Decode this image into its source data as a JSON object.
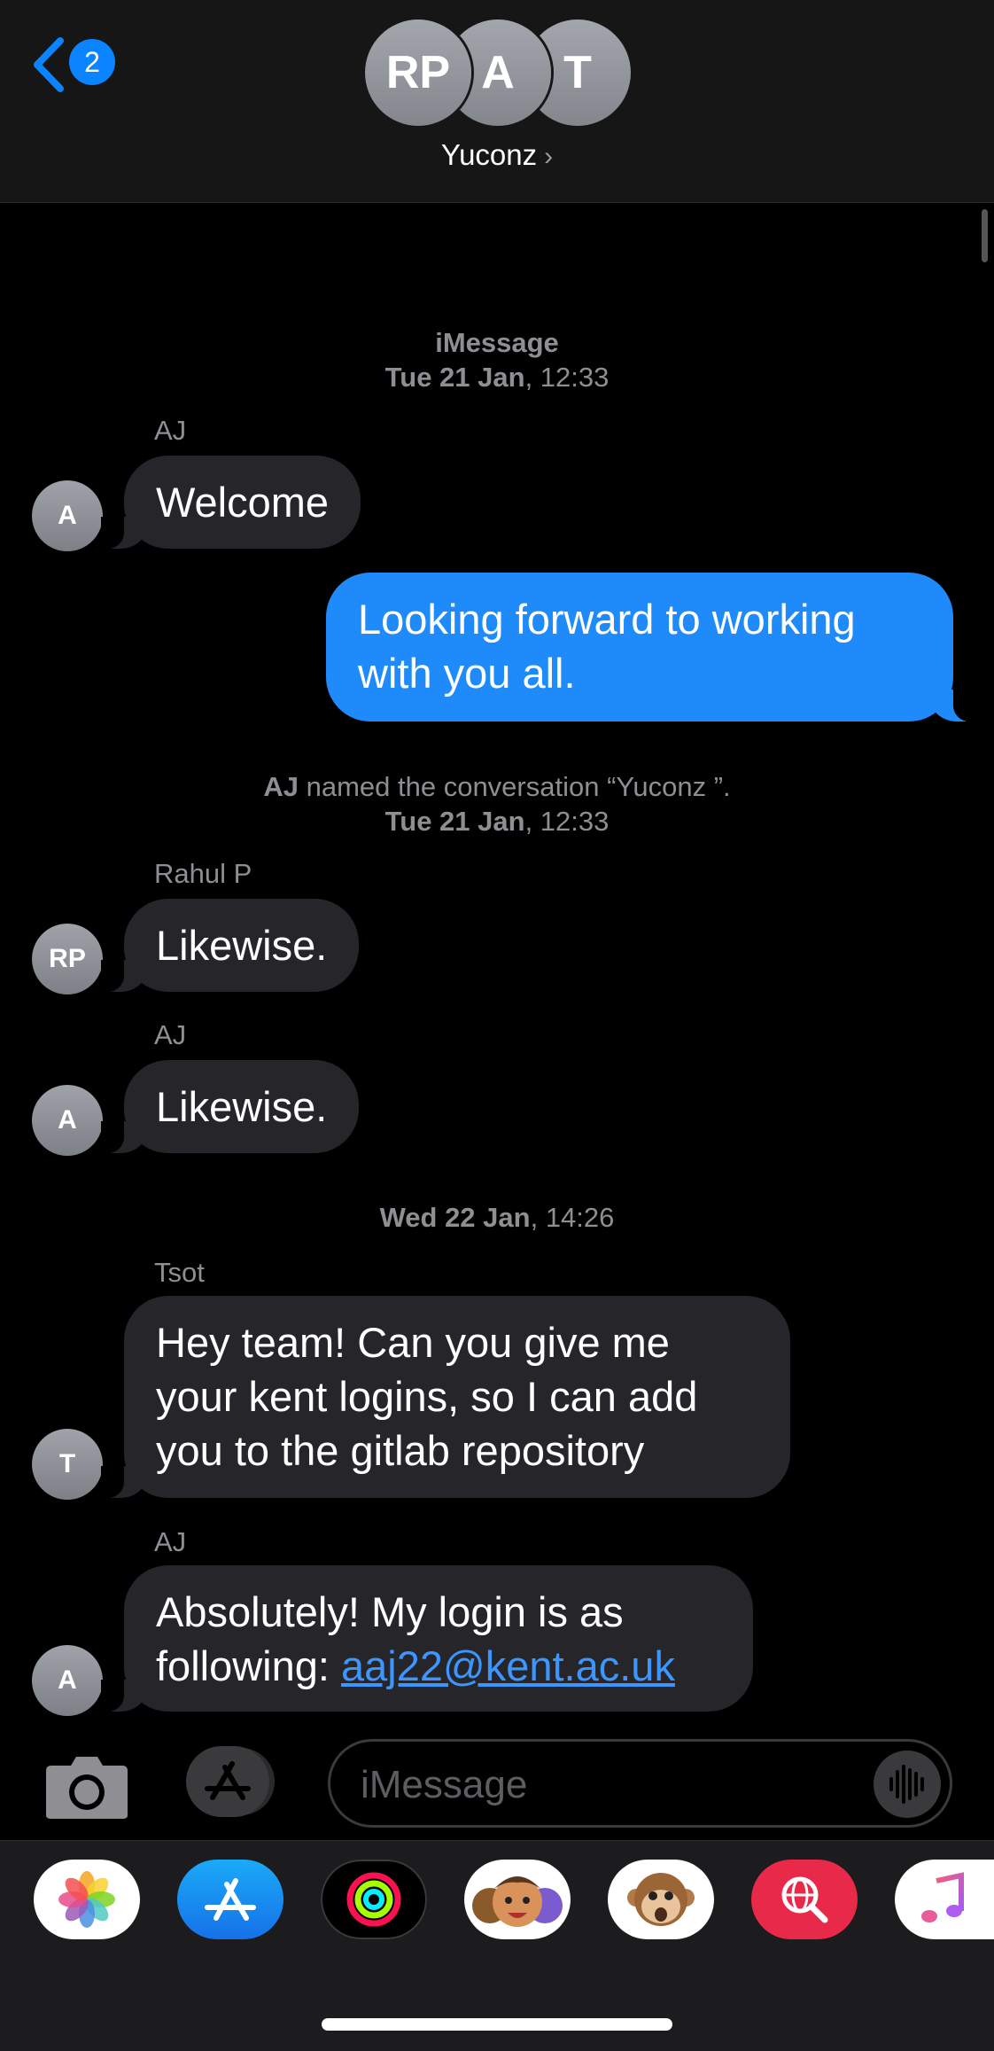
{
  "header": {
    "back_badge": "2",
    "group_avatars": [
      "RP",
      "A",
      "T"
    ],
    "group_name": "Yuconz",
    "chevron": "›"
  },
  "thread": {
    "service_label": "iMessage",
    "timestamp1_day": "Tue 21 Jan",
    "timestamp1_time": ", 12:33",
    "msg1": {
      "sender": "AJ",
      "avatar": "A",
      "text": "Welcome"
    },
    "msg2": {
      "line1": "Looking forward to working",
      "line2": "with you all."
    },
    "rename_actor": "AJ",
    "rename_text": " named the conversation “Yuconz ”.",
    "timestamp2_day": "Tue 21 Jan",
    "timestamp2_time": ", 12:33",
    "msg3": {
      "sender": "Rahul P",
      "avatar": "RP",
      "text": "Likewise."
    },
    "msg4": {
      "sender": "AJ",
      "avatar": "A",
      "text": "Likewise."
    },
    "timestamp3_day": "Wed 22 Jan",
    "timestamp3_time": ", 14:26",
    "msg5": {
      "sender": "Tsot",
      "avatar": "T",
      "line1": "Hey team! Can you give me",
      "line2": "your kent logins, so I can add",
      "line3": "you to the gitlab repository"
    },
    "msg6": {
      "sender": "AJ",
      "avatar": "A",
      "line1": "Absolutely! My login is as",
      "line2_prefix": "following: ",
      "link": "aaj22@kent.ac.uk"
    }
  },
  "input": {
    "placeholder": "iMessage"
  },
  "drawer": {
    "apps": [
      "photos-icon",
      "app-store-icon",
      "activity-icon",
      "memoji-icon",
      "animoji-monkey-icon",
      "web-search-icon",
      "music-icon"
    ]
  },
  "colors": {
    "accent": "#0a84ff",
    "outgoing_bubble": "#1f8bfa",
    "incoming_bubble": "#26252a",
    "meta_text": "#8e8e93"
  }
}
